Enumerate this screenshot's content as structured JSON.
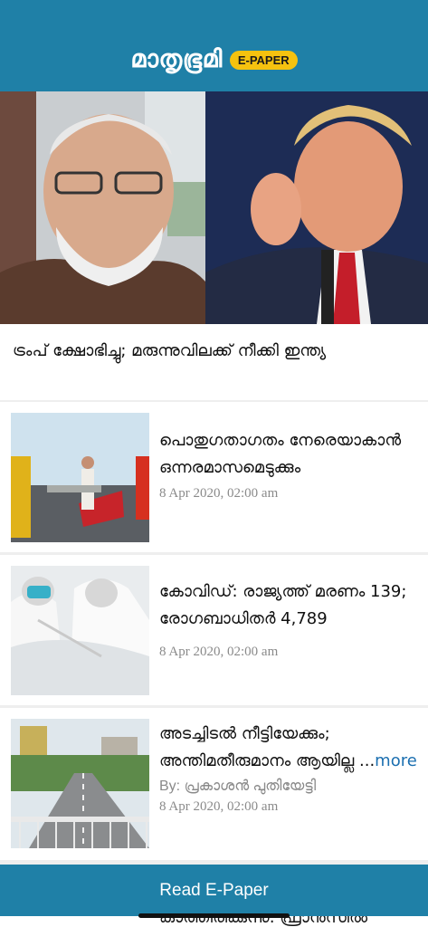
{
  "header": {
    "brand_name": "മാതൃഭൂമി",
    "badge": "E-PAPER"
  },
  "hero": {
    "headline": "ട്രംപ് ക്ഷോഭിച്ചു; മരുന്നുവിലക്ക് നീക്കി ഇന്ത്യ"
  },
  "articles": [
    {
      "title": "പൊതുഗതാഗതം നേരെയാകാൻ ഒന്നരമാസമെടുക്കും",
      "date": "8 Apr 2020, 02:00 am"
    },
    {
      "title": "കോവിഡ്: രാജ്യത്ത് മരണം 139; രോഗബാധിതർ 4,789",
      "date": "8 Apr 2020, 02:00 am"
    },
    {
      "title": "അടച്ചിടൽ നീട്ടിയേക്കും; അന്തിമതീരുമാനം ആയില്ല ...",
      "more": "more",
      "byline": "By: പ്രകാശൻ പുതിയേട്ടി",
      "date": "8 Apr 2020, 02:00 am"
    }
  ],
  "footer": {
    "read_button": "Read E-Paper",
    "peek_text": "കാത്തിരിക്കുന്നു: ഫ്രാൻസിൽ"
  },
  "colors": {
    "header_bg": "#1f80a7",
    "badge_bg": "#f5c20f",
    "link": "#1b6fb0"
  }
}
